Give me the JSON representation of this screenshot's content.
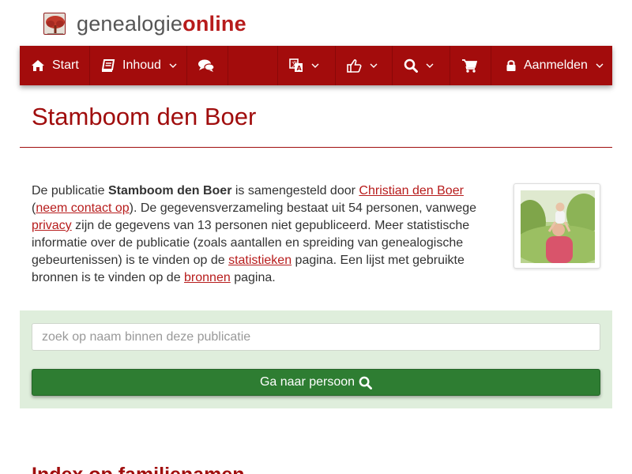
{
  "brand": {
    "name_prefix": "genealogie",
    "name_suffix": "online"
  },
  "nav": {
    "start": {
      "label": "Start",
      "icon": "home-icon"
    },
    "contents": {
      "label": "Inhoud",
      "icon": "book-icon"
    },
    "chat": {
      "icon": "comments-icon"
    },
    "language": {
      "icon": "language-icon"
    },
    "share": {
      "icon": "thumbs-up-icon"
    },
    "search": {
      "icon": "search-icon"
    },
    "cart": {
      "icon": "shopping-cart-icon"
    },
    "login": {
      "label": "Aanmelden",
      "icon": "lock-icon"
    }
  },
  "page": {
    "title": "Stamboom den Boer"
  },
  "intro": {
    "t1": "De publicatie ",
    "pub_name": "Stamboom den Boer",
    "t2": " is samengesteld door ",
    "author": "Christian den Boer",
    "t3": " (",
    "contact": "neem contact op",
    "t4": "). De gegevensverzameling bestaat uit 54 personen, vanwege ",
    "privacy": "privacy",
    "t5": " zijn de gegevens van 13 personen niet gepubliceerd. Meer statistische informatie over de publicatie (zoals aantallen en spreiding van genealogische gebeurtenissen) is te vinden op de ",
    "stats": "statistieken",
    "t6": " pagina. Een lijst met gebruikte bronnen is te vinden op de ",
    "sources": "bronnen",
    "t7": " pagina."
  },
  "search": {
    "placeholder": "zoek op naam binnen deze publicatie",
    "button_label": "Ga naar persoon"
  },
  "sections": {
    "surname_index": "Index op familienamen"
  },
  "colors": {
    "brand_red": "#a30c0c",
    "link_red": "#b71c1c",
    "button_green": "#2e7d32",
    "panel_green": "#dfeedc"
  }
}
